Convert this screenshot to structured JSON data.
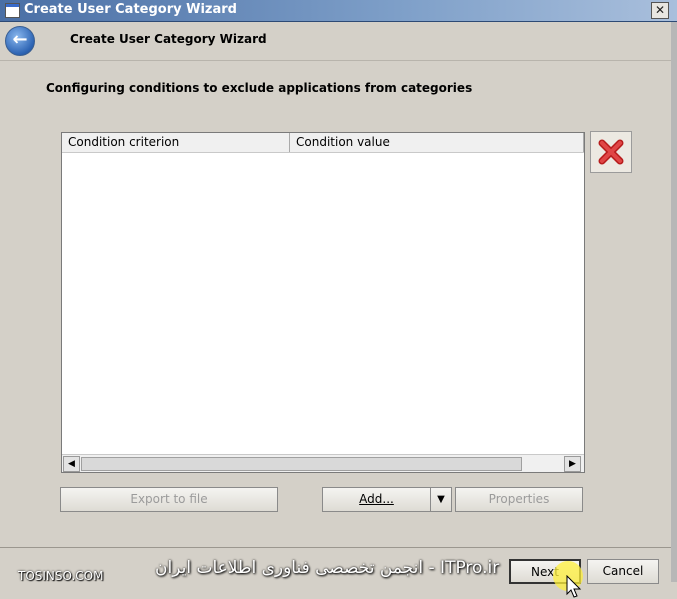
{
  "window": {
    "title": "Create User Category Wizard",
    "close_glyph": "✕"
  },
  "header": {
    "title": "Create User Category Wizard",
    "back_glyph": "←"
  },
  "section": {
    "heading": "Configuring conditions to exclude applications from categories"
  },
  "grid": {
    "columns": [
      "Condition criterion",
      "Condition value"
    ],
    "rows": [],
    "scroll_left": "◀",
    "scroll_right": "▶"
  },
  "buttons": {
    "export": "Export to file",
    "add": "Add...",
    "add_dropdown": "▼",
    "properties": "Properties",
    "next": "Next",
    "cancel": "Cancel"
  },
  "watermark": {
    "left": "TOSINSO.COM",
    "right": "انجمن تخصصی فناوری اطلاعات ایران - ITPro.ir"
  },
  "icons": {
    "remove": "red-x-icon",
    "back": "back-arrow-icon",
    "cursor": "mouse-pointer-icon"
  }
}
